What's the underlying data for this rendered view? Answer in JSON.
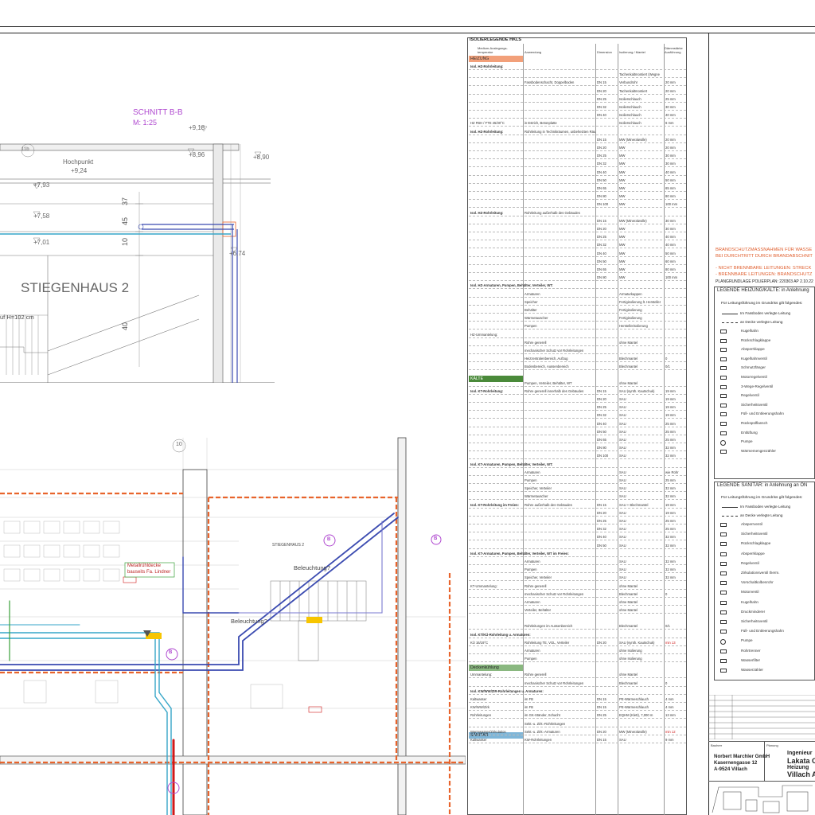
{
  "section_view": {
    "title": "SCHNITT B-B",
    "scale": "M: 1:25",
    "room_label": "STIEGENHAUS 2",
    "highpoint_label": "Hochpunkt",
    "highpoint_level": "+9,24",
    "levels": [
      "+9,18",
      "+8,96",
      "+8,90",
      "+7,93",
      "+7,58",
      "+7,01",
      "+6,74"
    ],
    "dims": [
      "37",
      "45",
      "10",
      "40"
    ],
    "handrail_note": "uf H=102 cm",
    "axis_marker": "11b"
  },
  "plan_view": {
    "axis_marker": "10",
    "room_label": "STIEGENHAUS 2",
    "lighting_labels": [
      "Beleuchtung?",
      "Beleuchtung?"
    ],
    "note_green": [
      "Metallrühldecke",
      "bauseits Fa. Lindner"
    ],
    "bubble_labels": [
      "B",
      "B",
      "B"
    ]
  },
  "insulation_table": {
    "title": "ISOLIERLEGENDE HKLS",
    "headers": [
      "Medium-Auslegungs-temperatur",
      "Anwendung",
      "Dimension",
      "Isolierung / Mantel",
      "Dämmstärke Ausführung"
    ],
    "sections": [
      {
        "name": "HEIZUNG",
        "color": "#f2a07a"
      },
      {
        "name": "KÄLTE",
        "color": "#4a8a3a"
      },
      {
        "name": "Deckenkühlung",
        "color": "#8ab880"
      },
      {
        "name": "SANITÄR",
        "color": "#7fb6d8"
      }
    ],
    "rows": [
      {
        "group": "Isol. HZ-Rohrleitung:",
        "use": "",
        "dim": "",
        "ins": "",
        "thk": ""
      },
      {
        "group": "",
        "use": "",
        "dim": "",
        "ins": "Tachenkaltmontiert (Wegne",
        "thk": ""
      },
      {
        "group": "",
        "use": "Fassbodenschacht, Doppelboden",
        "dim": "DN 15",
        "ins": "Verbundrohr",
        "thk": "20 mm"
      },
      {
        "group": "",
        "use": "",
        "dim": "DN 20",
        "ins": "Tachenkaltmontiert",
        "thk": "20 mm"
      },
      {
        "group": "",
        "use": "",
        "dim": "DN 25",
        "ins": "Isolierschlauch",
        "thk": "25 mm"
      },
      {
        "group": "",
        "use": "",
        "dim": "DN 32",
        "ins": "Isolierschlauch",
        "thk": "30 mm"
      },
      {
        "group": "",
        "use": "",
        "dim": "DN 40",
        "ins": "Isolierschlauch",
        "thk": "40 mm"
      },
      {
        "group": "HZ FBH / FTE 45/30°C",
        "use": "in Estrich, Betonplatte",
        "dim": "",
        "ins": "Isolierschlauch",
        "thk": "6 mm"
      },
      {
        "group": "Isol. HZ-Rohrleitung:",
        "use": "Rohrleitung in Technikräumen, unbeheizten Räumen",
        "dim": "",
        "ins": "",
        "thk": ""
      },
      {
        "group": "",
        "use": "",
        "dim": "DN 15",
        "ins": "MW (Mineralwolle)",
        "thk": "20 mm"
      },
      {
        "group": "",
        "use": "",
        "dim": "DN 20",
        "ins": "MW",
        "thk": "20 mm"
      },
      {
        "group": "",
        "use": "",
        "dim": "DN 25",
        "ins": "MW",
        "thk": "30 mm"
      },
      {
        "group": "",
        "use": "",
        "dim": "DN 32",
        "ins": "MW",
        "thk": "30 mm"
      },
      {
        "group": "",
        "use": "",
        "dim": "DN 40",
        "ins": "MW",
        "thk": "40 mm"
      },
      {
        "group": "",
        "use": "",
        "dim": "DN 50",
        "ins": "MW",
        "thk": "50 mm"
      },
      {
        "group": "",
        "use": "",
        "dim": "DN 65",
        "ins": "MW",
        "thk": "65 mm"
      },
      {
        "group": "",
        "use": "",
        "dim": "DN 80",
        "ins": "MW",
        "thk": "80 mm"
      },
      {
        "group": "",
        "use": "",
        "dim": "DN 100",
        "ins": "MW",
        "thk": "100 mm"
      },
      {
        "group": "Isol. HZ-Rohrleitung:",
        "use": "Rohrleitung außerhalb des Gebäudes",
        "dim": "",
        "ins": "",
        "thk": ""
      },
      {
        "group": "",
        "use": "",
        "dim": "DN 15",
        "ins": "MW (Mineralwolle)",
        "thk": "30 mm"
      },
      {
        "group": "",
        "use": "",
        "dim": "DN 20",
        "ins": "MW",
        "thk": "30 mm"
      },
      {
        "group": "",
        "use": "",
        "dim": "DN 25",
        "ins": "MW",
        "thk": "40 mm"
      },
      {
        "group": "",
        "use": "",
        "dim": "DN 32",
        "ins": "MW",
        "thk": "40 mm"
      },
      {
        "group": "",
        "use": "",
        "dim": "DN 40",
        "ins": "MW",
        "thk": "50 mm"
      },
      {
        "group": "",
        "use": "",
        "dim": "DN 50",
        "ins": "MW",
        "thk": "60 mm"
      },
      {
        "group": "",
        "use": "",
        "dim": "DN 65",
        "ins": "MW",
        "thk": "80 mm"
      },
      {
        "group": "",
        "use": "",
        "dim": "DN 80",
        "ins": "MW",
        "thk": "100 mm"
      },
      {
        "group": "Isol. HZ-Armaturen, Pumpen, Behälter, Verteiler, WT:",
        "use": "",
        "dim": "",
        "ins": "",
        "thk": ""
      },
      {
        "group": "",
        "use": "Armaturen",
        "dim": "",
        "ins": "Armaturkappen",
        "thk": ""
      },
      {
        "group": "",
        "use": "Speicher",
        "dim": "",
        "ins": "Fertigisolierung lt. Hersteller",
        "thk": ""
      },
      {
        "group": "",
        "use": "Behälter",
        "dim": "",
        "ins": "Fertigisolierung",
        "thk": ""
      },
      {
        "group": "",
        "use": "Wärmetauscher",
        "dim": "",
        "ins": "Fertigisolierung",
        "thk": ""
      },
      {
        "group": "",
        "use": "Pumpen",
        "dim": "",
        "ins": "Herstellerisolierung",
        "thk": ""
      },
      {
        "group": "HZ-Ummantelung:",
        "use": "",
        "dim": "",
        "ins": "",
        "thk": ""
      },
      {
        "group": "",
        "use": "Rohre generell",
        "dim": "",
        "ins": "ohne Mantel",
        "thk": ""
      },
      {
        "group": "",
        "use": "mechanischer Schutz vor Rohrleitungen",
        "dim": "",
        "ins": "",
        "thk": ""
      },
      {
        "group": "",
        "use": "Heizzentralenbereich, Aufzug",
        "dim": "",
        "ins": "Blechmantel",
        "thk": "0"
      },
      {
        "group": "",
        "use": "Bodenbereich, Aussenbereich",
        "dim": "",
        "ins": "Blechmantel",
        "thk": "0/1"
      },
      {
        "group": "",
        "use": "Pumpen, Verteiler, Behälter, WT",
        "dim": "",
        "ins": "ohne Mantel",
        "thk": ""
      },
      {
        "group": "Isol. KT-Rohrleitung:",
        "use": "Rohre generell innerhalb des Gebäudes",
        "dim": "DN 15",
        "ins": "SAU (synth. Kautschuk)",
        "thk": "19 mm"
      },
      {
        "group": "",
        "use": "",
        "dim": "DN 20",
        "ins": "SAU",
        "thk": "19 mm"
      },
      {
        "group": "",
        "use": "",
        "dim": "DN 25",
        "ins": "SAU",
        "thk": "19 mm"
      },
      {
        "group": "",
        "use": "",
        "dim": "DN 32",
        "ins": "SAU",
        "thk": "19 mm"
      },
      {
        "group": "",
        "use": "",
        "dim": "DN 40",
        "ins": "SAU",
        "thk": "25 mm"
      },
      {
        "group": "",
        "use": "",
        "dim": "DN 50",
        "ins": "SAU",
        "thk": "25 mm"
      },
      {
        "group": "",
        "use": "",
        "dim": "DN 65",
        "ins": "SAU",
        "thk": "25 mm"
      },
      {
        "group": "",
        "use": "",
        "dim": "DN 80",
        "ins": "SAU",
        "thk": "32 mm"
      },
      {
        "group": "",
        "use": "",
        "dim": "DN 100",
        "ins": "SAU",
        "thk": "32 mm"
      },
      {
        "group": "Isol. KT-Armaturen, Pumpen, Behälter, Verteiler, WT:",
        "use": "",
        "dim": "",
        "ins": "",
        "thk": ""
      },
      {
        "group": "",
        "use": "Armaturen",
        "dim": "",
        "ins": "SAU",
        "thk": "wie Rohr"
      },
      {
        "group": "",
        "use": "Pumpen",
        "dim": "",
        "ins": "SAU",
        "thk": "25 mm"
      },
      {
        "group": "",
        "use": "Speicher, Verteiler",
        "dim": "",
        "ins": "SAU",
        "thk": "32 mm"
      },
      {
        "group": "",
        "use": "Wärmetauscher",
        "dim": "",
        "ins": "SAU",
        "thk": "32 mm"
      },
      {
        "group": "Isol. KT-Rohrleitung im Freien:",
        "use": "Rohre außerhalb des Gebäudes",
        "dim": "DN 15",
        "ins": "SAU + Blechmantel",
        "thk": "19 mm"
      },
      {
        "group": "",
        "use": "",
        "dim": "DN 20",
        "ins": "SAU",
        "thk": "19 mm"
      },
      {
        "group": "",
        "use": "",
        "dim": "DN 25",
        "ins": "SAU",
        "thk": "25 mm"
      },
      {
        "group": "",
        "use": "",
        "dim": "DN 32",
        "ins": "SAU",
        "thk": "25 mm"
      },
      {
        "group": "",
        "use": "",
        "dim": "DN 40",
        "ins": "SAU",
        "thk": "32 mm"
      },
      {
        "group": "",
        "use": "",
        "dim": "DN 50",
        "ins": "SAU",
        "thk": "32 mm"
      },
      {
        "group": "Isol. KT-Armaturen, Pumpen, Behälter, Verteiler, WT im Freien:",
        "use": "",
        "dim": "",
        "ins": "",
        "thk": ""
      },
      {
        "group": "",
        "use": "Armaturen",
        "dim": "",
        "ins": "SAU",
        "thk": "32 mm"
      },
      {
        "group": "",
        "use": "Pumpen",
        "dim": "",
        "ins": "SAU",
        "thk": "32 mm"
      },
      {
        "group": "",
        "use": "Speicher, Verteiler",
        "dim": "",
        "ins": "SAU",
        "thk": "32 mm"
      },
      {
        "group": "KT-Ummantelung:",
        "use": "Rohre generell",
        "dim": "",
        "ins": "ohne Mantel",
        "thk": ""
      },
      {
        "group": "",
        "use": "mechanischer Schutz vor Rohrleitungen",
        "dim": "",
        "ins": "Blechmantel",
        "thk": "0"
      },
      {
        "group": "",
        "use": "Armaturen",
        "dim": "",
        "ins": "ohne Mantel",
        "thk": ""
      },
      {
        "group": "",
        "use": "Verteiler, Behälter",
        "dim": "",
        "ins": "ohne Mantel",
        "thk": ""
      },
      {
        "group": "",
        "use": "Rohrleitungen im Aussenbereich",
        "dim": "",
        "ins": "Blechmantel",
        "thk": "0/1"
      },
      {
        "group": "Isol. KT/KÜ-Rohrleitung u. Armaturen:",
        "use": "",
        "dim": "",
        "ins": "",
        "thk": ""
      },
      {
        "group": "KÜ 16/19°C",
        "use": "Rohrleitung TE, VGL, Verteiler",
        "dim": "DN 20",
        "ins": "SAU (synth. Kautschuk)",
        "thk": "min 13"
      },
      {
        "group": "",
        "use": "Armaturen",
        "dim": "",
        "ins": "ohne Isolierung",
        "thk": ""
      },
      {
        "group": "",
        "use": "Pumpen",
        "dim": "",
        "ins": "ohne Isolierung",
        "thk": ""
      },
      {
        "group": "Ummantelung:",
        "use": "Rohre generell",
        "dim": "",
        "ins": "ohne Mantel",
        "thk": ""
      },
      {
        "group": "",
        "use": "mechanischer Schutz vor Rohrleitungen",
        "dim": "",
        "ins": "Blechmantel",
        "thk": "0"
      },
      {
        "group": "Isol. KW/WW/ZIR-Rohrleitungen u. Armaturen:",
        "use": "",
        "dim": "",
        "ins": "",
        "thk": ""
      },
      {
        "group": "Kaltwasser",
        "use": "im FB",
        "dim": "DN 15",
        "ins": "PE-Wärmeschlauch",
        "thk": "4 mm"
      },
      {
        "group": "KW/WW/Zirk",
        "use": "im FB",
        "dim": "DN 15",
        "ins": "PE-Wärmeschlauch",
        "thk": "4 mm"
      },
      {
        "group": "Rohrleitungen",
        "use": "im GK-Ständer, Schacht",
        "dim": "DN 25",
        "ins": "EQHM (Klett), 7,000 m",
        "thk": "13 mm"
      },
      {
        "group": "",
        "use": "Sekt.-u. Zirk.-Rohrleitungen",
        "dim": "",
        "ins": "",
        "thk": ""
      },
      {
        "group": "Warmwasser/Zirkulation",
        "use": "Sekt.-u. Zirk.-Armaturen",
        "dim": "DN 20",
        "ins": "MW (Mineralwolle)",
        "thk": "min 12"
      },
      {
        "group": "Kaltwasser",
        "use": "KW-Rohrleitungen",
        "dim": "DN 15",
        "ins": "SAU",
        "thk": "9 mm"
      }
    ]
  },
  "fire_protection": {
    "title_lines": [
      "BRANDSCHUTZMASSNAHMEN FÜR WASSE",
      "BEI DURCHTRITT DURCH BRANDABSCHNIT"
    ],
    "items": [
      "- NICHT BRENNBARE LEITUNGEN: STRECK",
      "- BRENNBARE LEITUNGEN: BRANDSCHUTZ"
    ],
    "plan_basis": "PLANGRUNDLAGE POLIERPLAN:  220303 AP 2.10.22"
  },
  "legend_heating": {
    "title": "LEGENDE HEIZUNG/KÄLTE: in Anlehnung",
    "intro": "Für Leitungsführung im Grundriss gilt folgendes:",
    "line_items": [
      "Im Fassboden verlegte Leitung",
      "an Decke verlegte Leitung"
    ],
    "items": [
      "Kugelhahn",
      "Rückschlagklappe",
      "Absperrklappe",
      "Kugelhahnventil",
      "Schmutzfänger",
      "Motorregelventil",
      "3-Wege-Regelventil",
      "Regelventil",
      "Sicherheitsventil",
      "Füll- und Entleerungshahn",
      "Rückspülflansch",
      "Entlüftung",
      "Pumpe",
      "Wärmemengenzähler"
    ]
  },
  "legend_sanitary": {
    "title": "LEGENDE SANITÄR: in Anlehnung an ÖN",
    "intro": "Für Leitungsführung im Grundriss gilt folgendes:",
    "line_items": [
      "Im Fassboden verlegte Leitung",
      "an Decke verlegte Leitung"
    ],
    "items": [
      "Absperrventil",
      "Sicherheitsventil",
      "Rückschlagklappe",
      "Absperrklappe",
      "Regelventil",
      "Zirkulationsventil therm.",
      "Vorschaltkolbenrohr",
      "Motorventil",
      "Kugelhahn",
      "Druckminderer",
      "Sicherheitsventil",
      "Füll- und Entleerungshahn",
      "Pumpe",
      "Rohrtrenner",
      "Wasserfilter",
      "Wasserzähler"
    ]
  },
  "title_block": {
    "office": "Norbert Marchler GmbH",
    "street": "Kasernengasse 12",
    "city": "A-9524 Villach",
    "company_lines": [
      "Ingenieur",
      "Lakata C",
      "Heizung",
      "Villach A"
    ],
    "field_labels": [
      "Bauherr",
      "Planung"
    ]
  },
  "colors": {
    "heating_section": "#f2a07a",
    "cooling_section": "#4a8a3a",
    "purple_annotation": "#b04ad0",
    "pipe_blue": "#3a4ab0",
    "pipe_cyan": "#36a6c8",
    "fire_orange": "#e8642c",
    "red_pipe": "#d01818"
  }
}
